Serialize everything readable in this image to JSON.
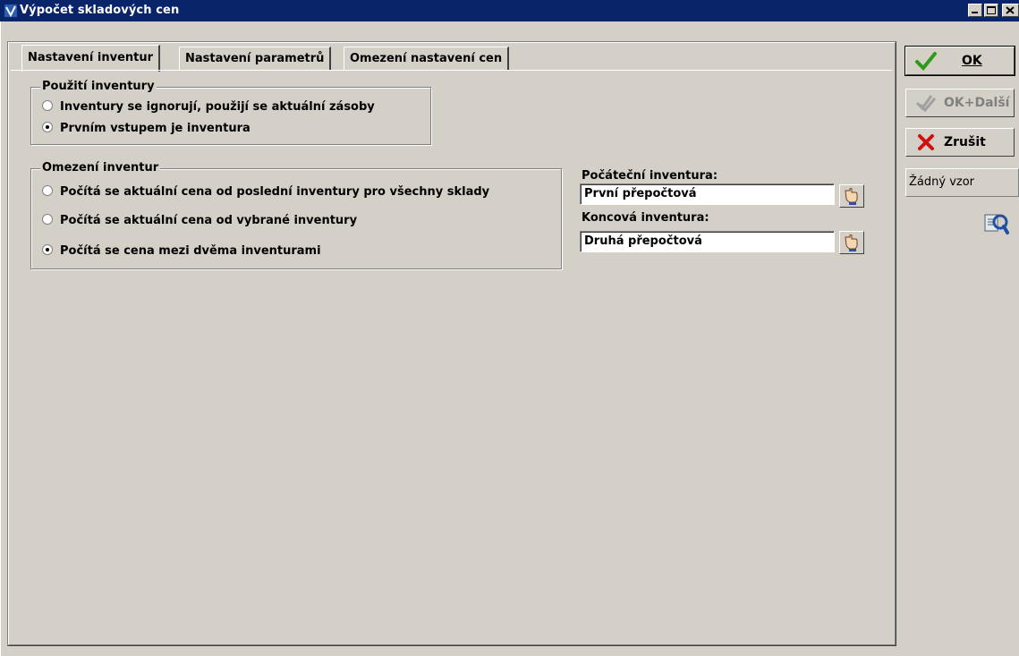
{
  "window": {
    "title": "Výpočet skladových cen"
  },
  "tabs": [
    {
      "label": "Nastavení inventur",
      "active": true
    },
    {
      "label": "Nastavení parametrů",
      "active": false
    },
    {
      "label": "Omezení nastavení cen",
      "active": false
    }
  ],
  "usage_group": {
    "legend": "Použití inventury",
    "options": [
      {
        "label": "Inventury se ignorují, použijí se aktuální zásoby",
        "checked": false
      },
      {
        "label": "Prvním vstupem je inventura",
        "checked": true
      }
    ]
  },
  "limit_group": {
    "legend": "Omezení inventur",
    "options": [
      {
        "label": "Počítá se aktuální cena od poslední inventury pro všechny sklady",
        "checked": false
      },
      {
        "label": "Počítá se aktuální cena od vybrané inventury",
        "checked": false
      },
      {
        "label": "Počítá se cena mezi dvěma inventurami",
        "checked": true
      }
    ]
  },
  "start_inventory": {
    "label": "Počáteční inventura:",
    "value": "První přepočtová"
  },
  "end_inventory": {
    "label": "Koncová inventura:",
    "value": "Druhá přepočtová"
  },
  "sidebar": {
    "ok_label": "OK",
    "ok_next_label": "OK+Další",
    "cancel_label": "Zrušit",
    "template_value": "Žádný vzor"
  },
  "colors": {
    "titlebar": "#0a246a",
    "face": "#d4d0c8",
    "ok_check": "#2e9a1a",
    "cancel_x": "#d01010"
  }
}
